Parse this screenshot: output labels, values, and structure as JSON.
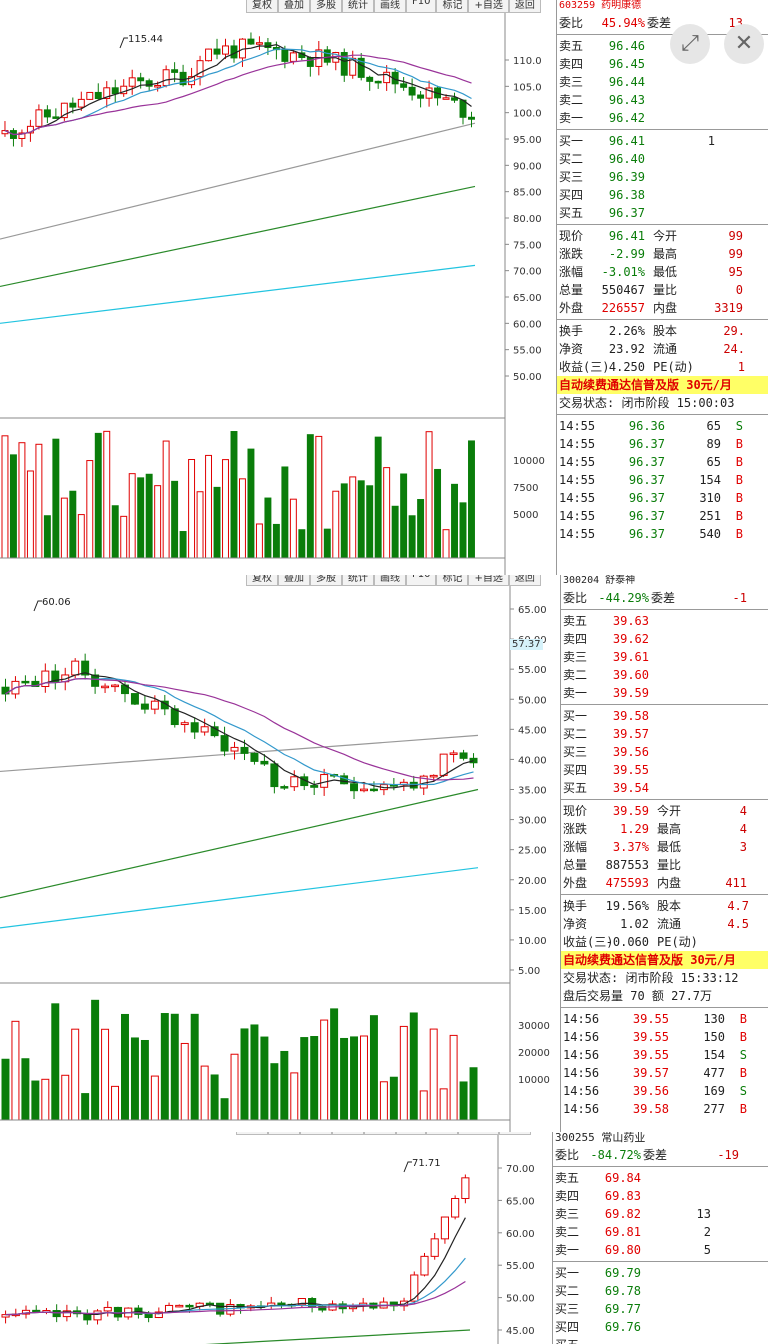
{
  "toolbar_labels": [
    "复权",
    "叠加",
    "多股",
    "统计",
    "画线",
    "F10",
    "标记",
    "+自选",
    "返回"
  ],
  "circle_buttons": {
    "expand": "⤢",
    "close": "✕"
  },
  "panels": [
    {
      "code_header": "603259 药明康德",
      "y_ticks": [
        "110.0",
        "105.0",
        "100.0",
        "95.00",
        "90.00",
        "85.00",
        "80.00",
        "75.00",
        "70.00",
        "65.00",
        "60.00",
        "55.00",
        "50.00"
      ],
      "vol_ticks": [
        "10000",
        "7500",
        "5000"
      ],
      "high_annot": "115.44",
      "weibi": {
        "label": "委比",
        "value": "45.94%",
        "label2": "委差",
        "value2": "13"
      },
      "sells": [
        {
          "label": "卖五",
          "price": "96.46"
        },
        {
          "label": "卖四",
          "price": "96.45"
        },
        {
          "label": "卖三",
          "price": "96.44"
        },
        {
          "label": "卖二",
          "price": "96.43"
        },
        {
          "label": "卖一",
          "price": "96.42"
        }
      ],
      "buys": [
        {
          "label": "买一",
          "price": "96.41",
          "vol": "1"
        },
        {
          "label": "买二",
          "price": "96.40",
          "vol": ""
        },
        {
          "label": "买三",
          "price": "96.39",
          "vol": ""
        },
        {
          "label": "买四",
          "price": "96.38",
          "vol": ""
        },
        {
          "label": "买五",
          "price": "96.37",
          "vol": ""
        }
      ],
      "stats": [
        {
          "l1": "现价",
          "v1": "96.41",
          "c1": "green",
          "l2": "今开",
          "v2": "99"
        },
        {
          "l1": "涨跌",
          "v1": "-2.99",
          "c1": "green",
          "l2": "最高",
          "v2": "99"
        },
        {
          "l1": "涨幅",
          "v1": "-3.01%",
          "c1": "green",
          "l2": "最低",
          "v2": "95"
        },
        {
          "l1": "总量",
          "v1": "550467",
          "c1": "black",
          "l2": "量比",
          "v2": "0"
        },
        {
          "l1": "外盘",
          "v1": "226557",
          "c1": "red",
          "l2": "内盘",
          "v2": "3319"
        }
      ],
      "stats2": [
        {
          "l1": "换手",
          "v1": "2.26%",
          "c1": "black",
          "l2": "股本",
          "v2": "29."
        },
        {
          "l1": "净资",
          "v1": "23.92",
          "c1": "black",
          "l2": "流通",
          "v2": "24."
        },
        {
          "l1": "收益(三)",
          "v1": "4.250",
          "c1": "black",
          "l2": "PE(动)",
          "v2": "1"
        }
      ],
      "banner": "自动续费通达信普及版  30元/月",
      "status": "交易状态: 闭市阶段 15:00:03",
      "trades": [
        {
          "t": "14:55",
          "p": "96.36",
          "v": "65",
          "f": "S"
        },
        {
          "t": "14:55",
          "p": "96.37",
          "v": "89",
          "f": "B"
        },
        {
          "t": "14:55",
          "p": "96.37",
          "v": "65",
          "f": "B"
        },
        {
          "t": "14:55",
          "p": "96.37",
          "v": "154",
          "f": "B"
        },
        {
          "t": "14:55",
          "p": "96.37",
          "v": "310",
          "f": "B"
        },
        {
          "t": "14:55",
          "p": "96.37",
          "v": "251",
          "f": "B"
        },
        {
          "t": "14:55",
          "p": "96.37",
          "v": "540",
          "f": "B"
        }
      ]
    },
    {
      "code_header": "300204 舒泰神",
      "y_ticks": [
        "65.00",
        "60.00",
        "55.00",
        "50.00",
        "45.00",
        "40.00",
        "35.00",
        "30.00",
        "25.00",
        "20.00",
        "15.00",
        "10.00",
        "5.00"
      ],
      "vol_ticks": [
        "30000",
        "20000",
        "10000"
      ],
      "high_annot": "60.06",
      "price_box": "57.37",
      "weibi": {
        "label": "委比",
        "value": "-44.29%",
        "label2": "委差",
        "value2": "-1"
      },
      "sells": [
        {
          "label": "卖五",
          "price": "39.63"
        },
        {
          "label": "卖四",
          "price": "39.62"
        },
        {
          "label": "卖三",
          "price": "39.61"
        },
        {
          "label": "卖二",
          "price": "39.60"
        },
        {
          "label": "卖一",
          "price": "39.59"
        }
      ],
      "buys": [
        {
          "label": "买一",
          "price": "39.58",
          "vol": ""
        },
        {
          "label": "买二",
          "price": "39.57",
          "vol": ""
        },
        {
          "label": "买三",
          "price": "39.56",
          "vol": ""
        },
        {
          "label": "买四",
          "price": "39.55",
          "vol": ""
        },
        {
          "label": "买五",
          "price": "39.54",
          "vol": ""
        }
      ],
      "stats": [
        {
          "l1": "现价",
          "v1": "39.59",
          "c1": "red",
          "l2": "今开",
          "v2": "4"
        },
        {
          "l1": "涨跌",
          "v1": "1.29",
          "c1": "red",
          "l2": "最高",
          "v2": "4"
        },
        {
          "l1": "涨幅",
          "v1": "3.37%",
          "c1": "red",
          "l2": "最低",
          "v2": "3"
        },
        {
          "l1": "总量",
          "v1": "887553",
          "c1": "black",
          "l2": "量比",
          "v2": ""
        },
        {
          "l1": "外盘",
          "v1": "475593",
          "c1": "red",
          "l2": "内盘",
          "v2": "411"
        }
      ],
      "stats2": [
        {
          "l1": "换手",
          "v1": "19.56%",
          "c1": "black",
          "l2": "股本",
          "v2": "4.7"
        },
        {
          "l1": "净资",
          "v1": "1.02",
          "c1": "black",
          "l2": "流通",
          "v2": "4.5"
        },
        {
          "l1": "收益(三)",
          "v1": "-0.060",
          "c1": "black",
          "l2": "PE(动)",
          "v2": ""
        }
      ],
      "banner": "自动续费通达信普及版  30元/月",
      "status": "交易状态: 闭市阶段 15:33:12",
      "status2": "盘后交易量 70 额 27.7万",
      "trades": [
        {
          "t": "14:56",
          "p": "39.55",
          "v": "130",
          "f": "B"
        },
        {
          "t": "14:56",
          "p": "39.55",
          "v": "150",
          "f": "B"
        },
        {
          "t": "14:56",
          "p": "39.55",
          "v": "154",
          "f": "S"
        },
        {
          "t": "14:56",
          "p": "39.57",
          "v": "477",
          "f": "B"
        },
        {
          "t": "14:56",
          "p": "39.56",
          "v": "169",
          "f": "S"
        },
        {
          "t": "14:56",
          "p": "39.58",
          "v": "277",
          "f": "B"
        }
      ]
    },
    {
      "code_header": "300255 常山药业",
      "y_ticks": [
        "70.00",
        "65.00",
        "60.00",
        "55.00",
        "50.00",
        "45.00"
      ],
      "high_annot": "71.71",
      "weibi": {
        "label": "委比",
        "value": "-84.72%",
        "label2": "委差",
        "value2": "-19"
      },
      "sells": [
        {
          "label": "卖五",
          "price": "69.84",
          "vol": ""
        },
        {
          "label": "卖四",
          "price": "69.83",
          "vol": ""
        },
        {
          "label": "卖三",
          "price": "69.82",
          "vol": "13"
        },
        {
          "label": "卖二",
          "price": "69.81",
          "vol": "2"
        },
        {
          "label": "卖一",
          "price": "69.80",
          "vol": "5"
        }
      ],
      "buys": [
        {
          "label": "买一",
          "price": "69.79",
          "vol": ""
        },
        {
          "label": "买二",
          "price": "69.78",
          "vol": ""
        },
        {
          "label": "买三",
          "price": "69.77",
          "vol": ""
        },
        {
          "label": "买四",
          "price": "69.76",
          "vol": ""
        },
        {
          "label": "买五",
          "price": "",
          "vol": ""
        }
      ]
    }
  ],
  "colors": {
    "up": "#e00000",
    "down": "#0a7d0a",
    "ma5": "#222222",
    "ma10": "#3399cc",
    "ma20": "#993399",
    "ma60": "#999999",
    "ma120": "#2a8a2a",
    "ma250": "#22c4e0"
  }
}
